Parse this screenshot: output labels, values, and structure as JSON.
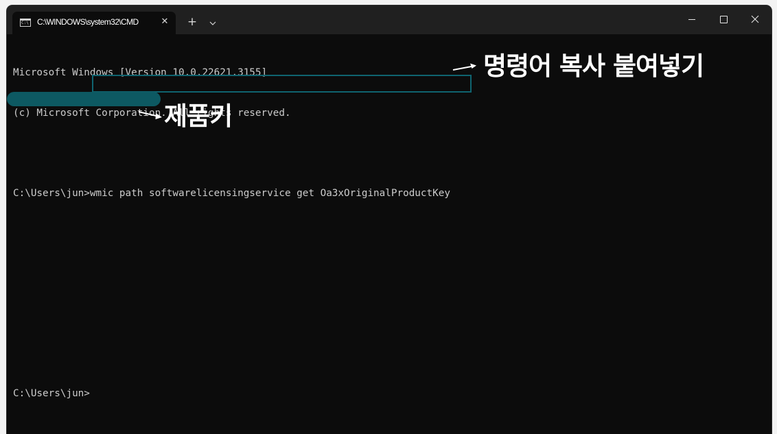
{
  "window": {
    "tab_title": "C:\\WINDOWS\\system32\\CMD",
    "tab_icon_text": "C:\\",
    "tab_close": "✕",
    "new_tab": "+"
  },
  "terminal": {
    "lines": [
      "Microsoft Windows [Version 10.0.22621.3155]",
      "(c) Microsoft Corporation. All rights reserved.",
      "",
      "C:\\Users\\jun>wmic path softwarelicensingservice get Oa3xOriginalProductKey",
      "",
      "",
      "",
      "",
      "C:\\Users\\jun>"
    ],
    "command": "wmic path softwarelicensingservice get Oa3xOriginalProductKey"
  },
  "annotations": {
    "copy_paste": "명령어 복사 붙여넣기",
    "product_key": "제품키"
  },
  "colors": {
    "terminal_bg": "#0c0c0c",
    "titlebar_bg": "#202020",
    "highlight": "#0f6470",
    "mask": "#0d5962",
    "text": "#cccccc"
  }
}
